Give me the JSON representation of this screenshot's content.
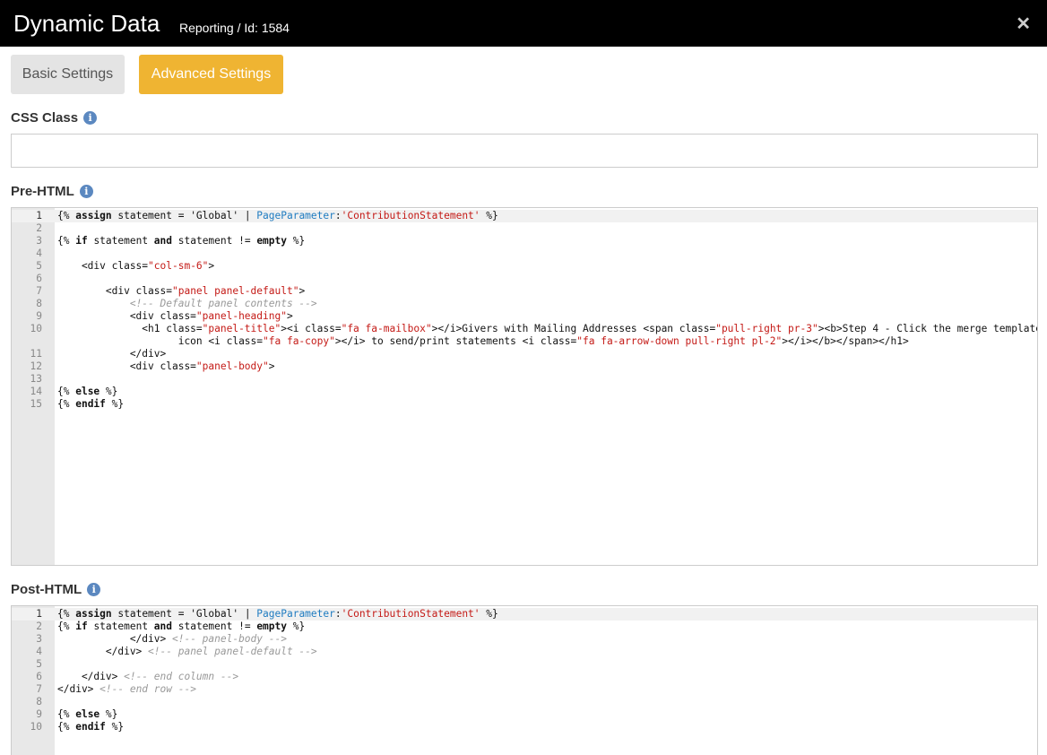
{
  "header": {
    "title": "Dynamic Data",
    "subtitle": "Reporting / Id: 1584",
    "close_icon": "close-icon"
  },
  "tabs": {
    "basic": "Basic Settings",
    "advanced": "Advanced Settings",
    "active_color": "#efb432"
  },
  "fields": {
    "css_class_label": "CSS Class",
    "css_class_value": "",
    "pre_html_label": "Pre-HTML",
    "post_html_label": "Post-HTML",
    "info_icon": "info-icon"
  },
  "pre_html": {
    "line_numbers": [
      "1",
      "2",
      "3",
      "4",
      "5",
      "6",
      "7",
      "8",
      "9",
      "10",
      "11",
      "12",
      "13",
      "14",
      "15"
    ]
  },
  "post_html": {
    "line_numbers": [
      "1",
      "2",
      "3",
      "4",
      "5",
      "6",
      "7",
      "8",
      "9",
      "10"
    ]
  }
}
